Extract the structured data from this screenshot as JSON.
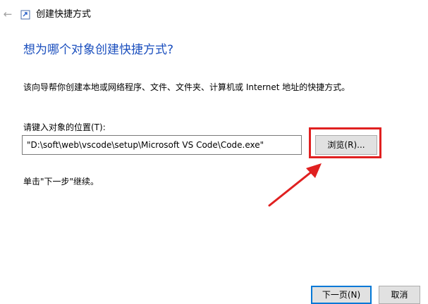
{
  "window": {
    "title": "创建快捷方式",
    "back_glyph": "←",
    "back_icon": "back-arrow-icon",
    "app_icon": "shortcut-app-icon"
  },
  "wizard": {
    "heading": "想为哪个对象创建快捷方式?",
    "description": "该向导帮你创建本地或网络程序、文件、文件夹、计算机或 Internet 地址的快捷方式。",
    "location_label": "请键入对象的位置(T):",
    "location_value": "\"D:\\soft\\web\\vscode\\setup\\Microsoft VS Code\\Code.exe\"",
    "browse_label": "浏览(R)...",
    "hint": "单击\"下一步\"继续。"
  },
  "footer": {
    "next_label": "下一页(N)",
    "cancel_label": "取消"
  },
  "annotation": {
    "color": "#e02020",
    "type": "red-box-and-arrow-highlighting-browse-button"
  },
  "colors": {
    "heading": "#1b4fbe",
    "button_bg": "#e1e1e1",
    "focus_border": "#0078d7"
  }
}
